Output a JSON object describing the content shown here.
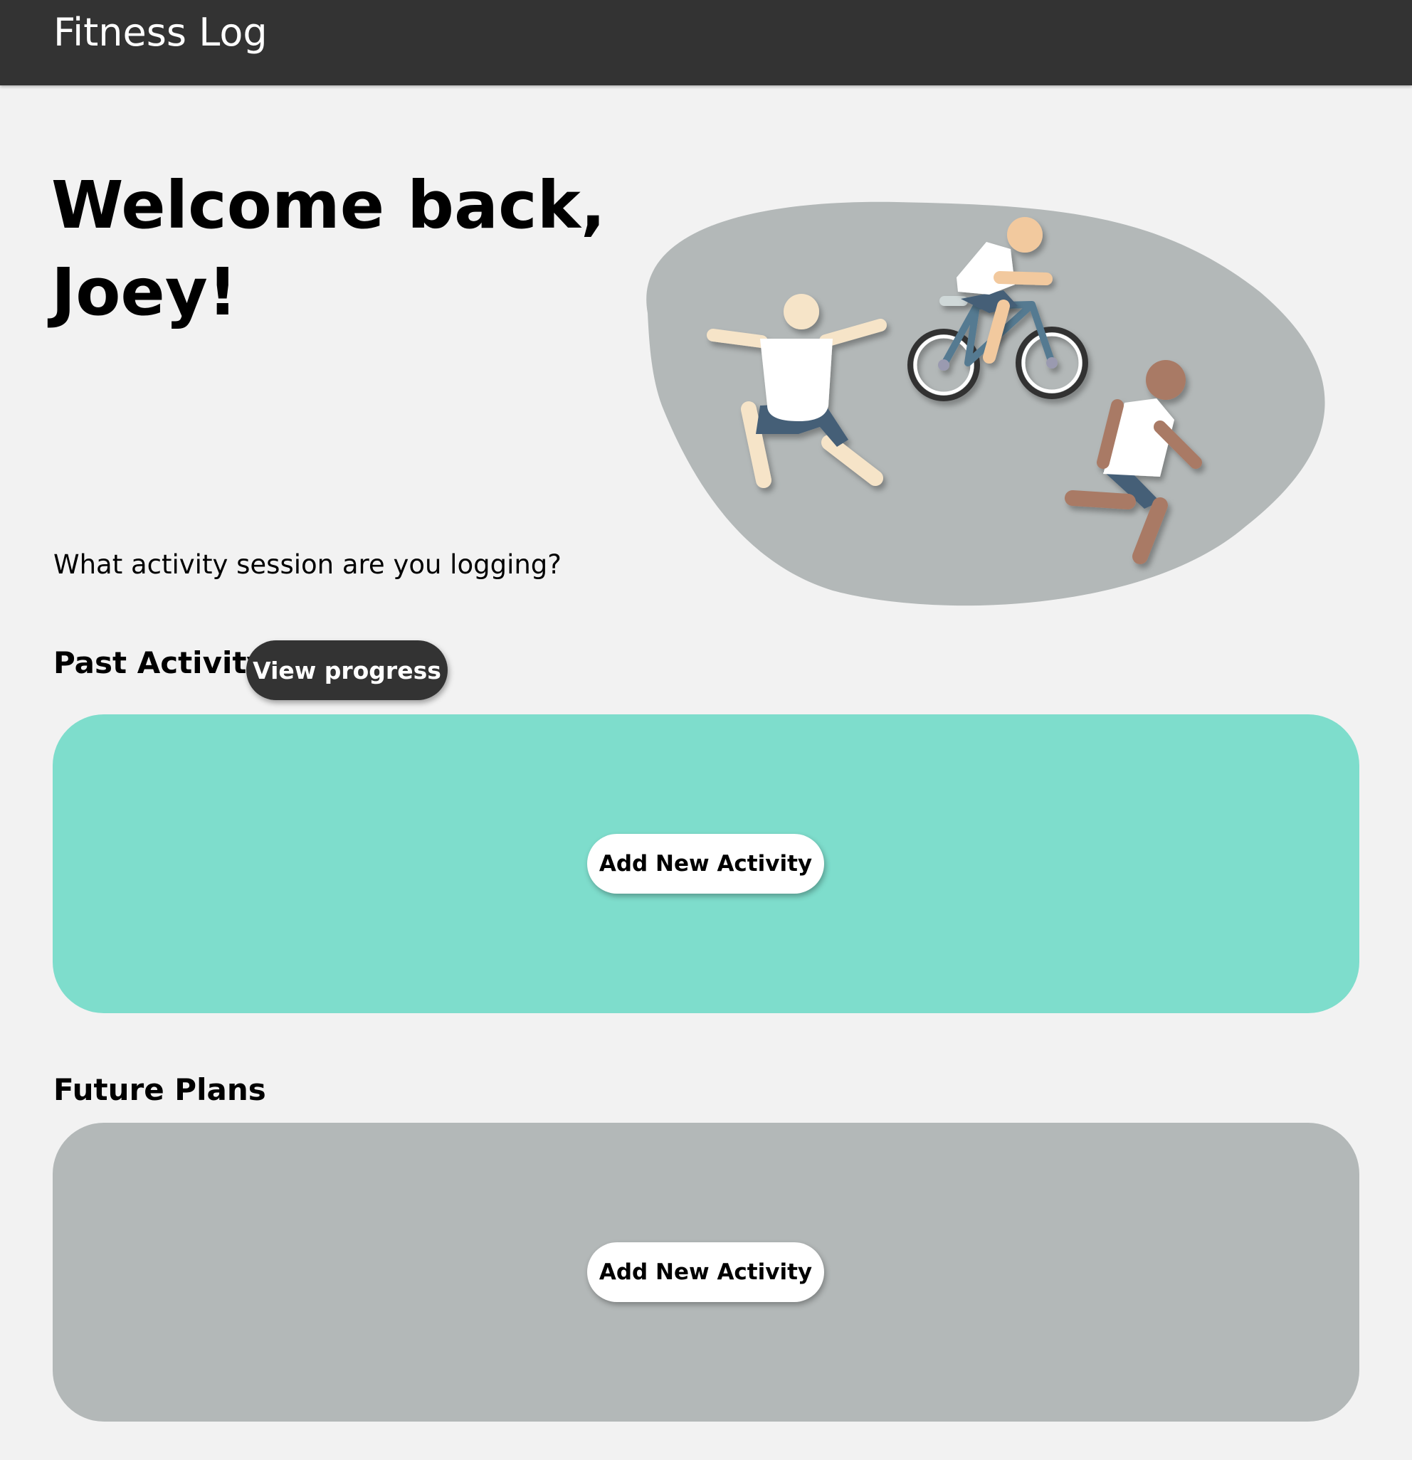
{
  "header": {
    "app_title": "Fitness Log",
    "background_color": "#333333"
  },
  "hero": {
    "welcome_text": "Welcome back, Joey!",
    "prompt_text": "What activity session are you logging?",
    "illustration": "people-exercising-illustration"
  },
  "past_activity": {
    "title": "Past Activity",
    "view_progress_label": "View progress",
    "add_button_label": "Add New Activity",
    "panel_color": "#7eddcc"
  },
  "future_plans": {
    "title": "Future Plans",
    "add_button_label": "Add New Activity",
    "panel_color": "#b3b8b8"
  },
  "colors": {
    "page_background": "#f2f2f2",
    "accent_dark": "#333333"
  }
}
